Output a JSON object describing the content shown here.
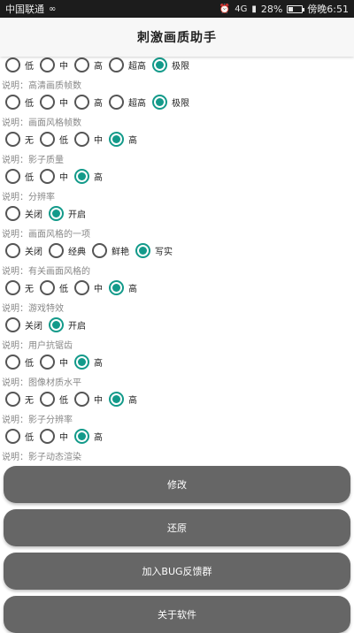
{
  "status_bar": {
    "carrier": "中国联通",
    "signal_text": "4G",
    "battery": "28%",
    "time": "傍晚6:51"
  },
  "app_bar": {
    "title": "刺激画质助手"
  },
  "settings": [
    {
      "options": [
        {
          "label": "低",
          "checked": false
        },
        {
          "label": "中",
          "checked": false
        },
        {
          "label": "高",
          "checked": false
        },
        {
          "label": "超高",
          "checked": false
        },
        {
          "label": "极限",
          "checked": true
        }
      ],
      "description": "说明：高清画质帧数"
    },
    {
      "options": [
        {
          "label": "低",
          "checked": false
        },
        {
          "label": "中",
          "checked": false
        },
        {
          "label": "高",
          "checked": false
        },
        {
          "label": "超高",
          "checked": false
        },
        {
          "label": "极限",
          "checked": true
        }
      ],
      "description": "说明：画面风格帧数"
    },
    {
      "options": [
        {
          "label": "无",
          "checked": false
        },
        {
          "label": "低",
          "checked": false
        },
        {
          "label": "中",
          "checked": false
        },
        {
          "label": "高",
          "checked": true
        }
      ],
      "description": "说明：影子质量"
    },
    {
      "options": [
        {
          "label": "低",
          "checked": false
        },
        {
          "label": "中",
          "checked": false
        },
        {
          "label": "高",
          "checked": true
        }
      ],
      "description": "说明：分辨率"
    },
    {
      "options": [
        {
          "label": "关闭",
          "checked": false
        },
        {
          "label": "开启",
          "checked": true
        }
      ],
      "description": "说明：画面风格的一项"
    },
    {
      "options": [
        {
          "label": "关闭",
          "checked": false
        },
        {
          "label": "经典",
          "checked": false
        },
        {
          "label": "鲜艳",
          "checked": false
        },
        {
          "label": "写实",
          "checked": true
        }
      ],
      "description": "说明：有关画面风格的"
    },
    {
      "options": [
        {
          "label": "无",
          "checked": false
        },
        {
          "label": "低",
          "checked": false
        },
        {
          "label": "中",
          "checked": false
        },
        {
          "label": "高",
          "checked": true
        }
      ],
      "description": "说明：游戏特效"
    },
    {
      "options": [
        {
          "label": "关闭",
          "checked": false
        },
        {
          "label": "开启",
          "checked": true
        }
      ],
      "description": "说明：用户抗锯齿"
    },
    {
      "options": [
        {
          "label": "低",
          "checked": false
        },
        {
          "label": "中",
          "checked": false
        },
        {
          "label": "高",
          "checked": true
        }
      ],
      "description": "说明：图像材质水平"
    },
    {
      "options": [
        {
          "label": "无",
          "checked": false
        },
        {
          "label": "低",
          "checked": false
        },
        {
          "label": "中",
          "checked": false
        },
        {
          "label": "高",
          "checked": true
        }
      ],
      "description": "说明：影子分辨率"
    },
    {
      "options": [
        {
          "label": "低",
          "checked": false
        },
        {
          "label": "中",
          "checked": false
        },
        {
          "label": "高",
          "checked": true
        }
      ],
      "description": "说明：影子动态渲染"
    }
  ],
  "buttons": {
    "modify": "修改",
    "restore": "还原",
    "join_bug_group": "加入BUG反馈群",
    "about": "关于软件"
  },
  "colors": {
    "accent": "#139a8a",
    "button_bg": "#666666",
    "status_bar_bg": "#1c1c1c"
  }
}
